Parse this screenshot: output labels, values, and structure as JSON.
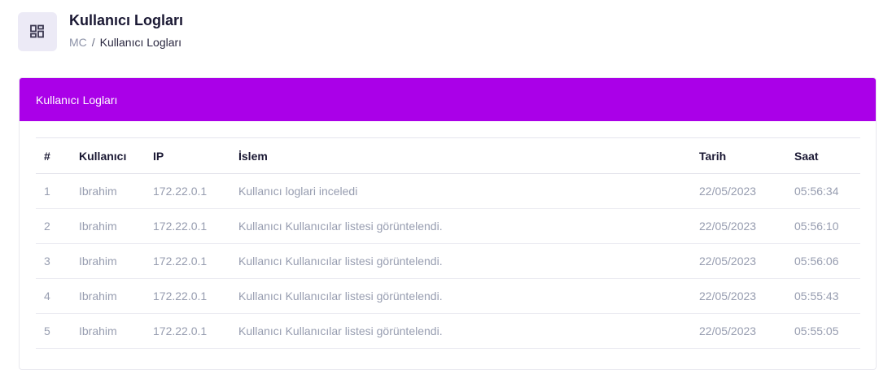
{
  "header": {
    "title": "Kullanıcı Logları",
    "icon": "dashboard-grid-icon",
    "breadcrumb": {
      "root": "MC",
      "separator": "/",
      "current": "Kullanıcı Logları"
    }
  },
  "card": {
    "title": "Kullanıcı Logları",
    "accent_color": "#aa00e8"
  },
  "table": {
    "columns": [
      "#",
      "Kullanıcı",
      "IP",
      "İslem",
      "Tarih",
      "Saat"
    ],
    "rows": [
      {
        "num": "1",
        "user": "Ibrahim",
        "ip": "172.22.0.1",
        "op": "Kullanıcı loglari inceledi",
        "date": "22/05/2023",
        "time": "05:56:34"
      },
      {
        "num": "2",
        "user": "Ibrahim",
        "ip": "172.22.0.1",
        "op": "Kullanıcı Kullanıcılar listesi görüntelendi.",
        "date": "22/05/2023",
        "time": "05:56:10"
      },
      {
        "num": "3",
        "user": "Ibrahim",
        "ip": "172.22.0.1",
        "op": "Kullanıcı Kullanıcılar listesi görüntelendi.",
        "date": "22/05/2023",
        "time": "05:56:06"
      },
      {
        "num": "4",
        "user": "Ibrahim",
        "ip": "172.22.0.1",
        "op": "Kullanıcı Kullanıcılar listesi görüntelendi.",
        "date": "22/05/2023",
        "time": "05:55:43"
      },
      {
        "num": "5",
        "user": "Ibrahim",
        "ip": "172.22.0.1",
        "op": "Kullanıcı Kullanıcılar listesi görüntelendi.",
        "date": "22/05/2023",
        "time": "05:55:05"
      }
    ]
  }
}
